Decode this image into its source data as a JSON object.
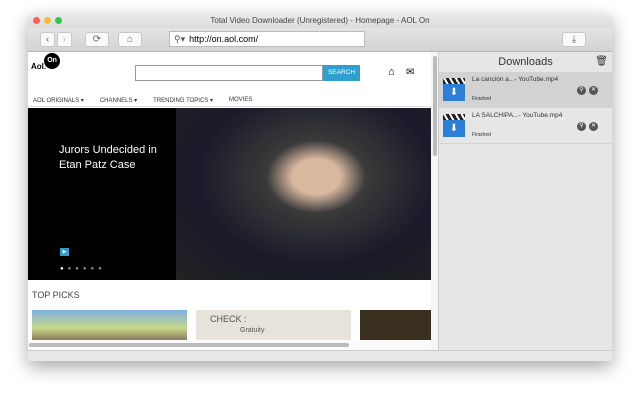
{
  "window": {
    "title": "Total Video Downloader (Unregistered) - Homepage - AOL On"
  },
  "toolbar": {
    "back": "‹",
    "forward": "›",
    "reload": "⟳",
    "home": "⌂",
    "search_icon": "⚲▾",
    "url": "http://on.aol.com/",
    "download": "⤓"
  },
  "page": {
    "logo": "Aol.",
    "logo_on": "On",
    "search_button": "SEARCH",
    "search_value": "",
    "nav": [
      "AOL ORIGINALS ▾",
      "CHANNELS ▾",
      "TRENDING TOPICS ▾",
      "MOVIES"
    ],
    "hero_title": "Jurors Undecided in Etan Patz Case",
    "section_title": "TOP PICKS",
    "thumb2_text": "CHECK :",
    "thumb2_sub": "Gratuity"
  },
  "downloads": {
    "title": "Downloads",
    "items": [
      {
        "name": "La canción a...- YouTube.mp4",
        "status": "Finished"
      },
      {
        "name": "LA SALCHIPA...- YouTube.mp4",
        "status": "Finished"
      }
    ]
  }
}
